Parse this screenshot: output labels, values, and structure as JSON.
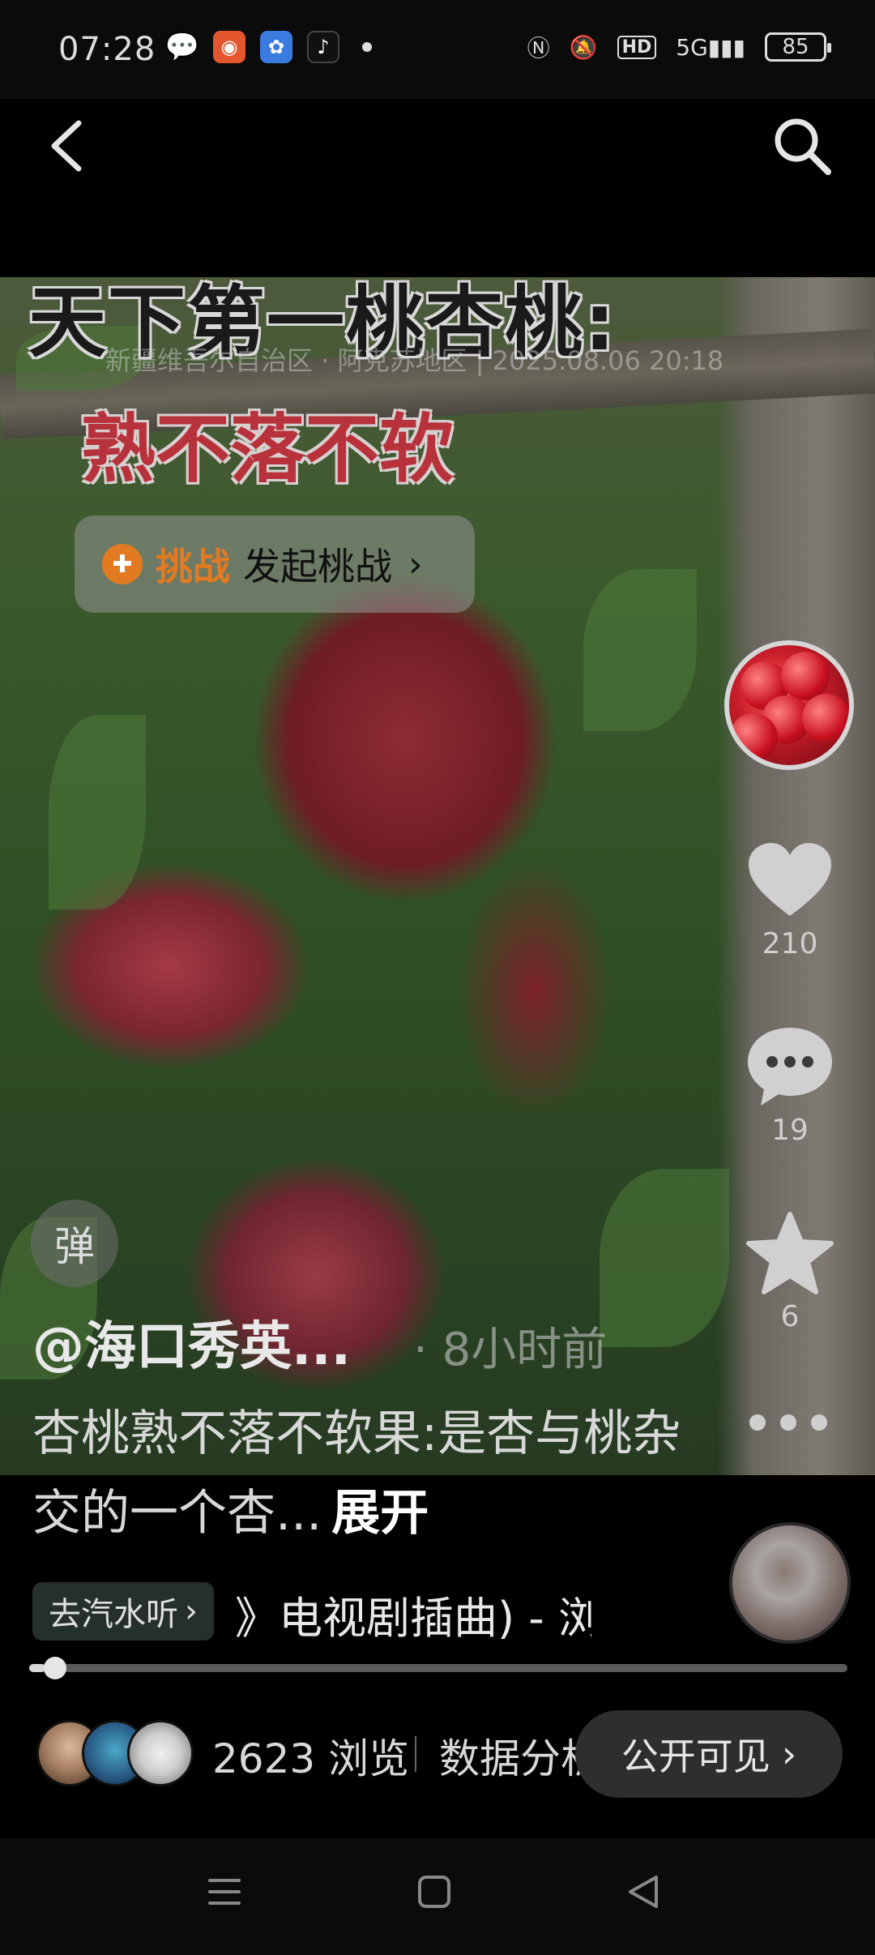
{
  "status_bar": {
    "time": "07:28",
    "battery": "85",
    "network": "5G",
    "hd": "HD",
    "icons": [
      "wechat-icon",
      "app-orange-icon",
      "baidu-icon",
      "tiktok-icon",
      "nfc-icon",
      "mute-icon",
      "signal-icon",
      "battery-icon"
    ]
  },
  "video": {
    "title": "天下第一桃杏桃:",
    "subtitle": "熟不落不软",
    "watermark": "新疆维吾尔自治区 · 阿克苏地区 | 2025.08.06 20:18",
    "challenge": {
      "tag": "挑战",
      "text": "发起桃战",
      "arrow": "›"
    },
    "danmu_label": "弹"
  },
  "actions": {
    "likes": "210",
    "comments": "19",
    "favorites": "6"
  },
  "post": {
    "author": "@海口秀英...",
    "time": "· 8小时前",
    "description": "杏桃熟不落不软果:是杏与桃杂交的一个杏...",
    "expand": "展开"
  },
  "music": {
    "tag_label": "去汽水听",
    "tag_arrow": "›",
    "song": "》电视剧插曲) - 浏"
  },
  "progress": {
    "value": 0.02
  },
  "footer": {
    "views": "2623 浏览",
    "analytics": "数据分析",
    "visibility": "公开可见",
    "visibility_arrow": "›"
  },
  "colors": {
    "accent_orange": "#e27a22",
    "subtitle_red": "#b8323b",
    "background": "#000000"
  }
}
